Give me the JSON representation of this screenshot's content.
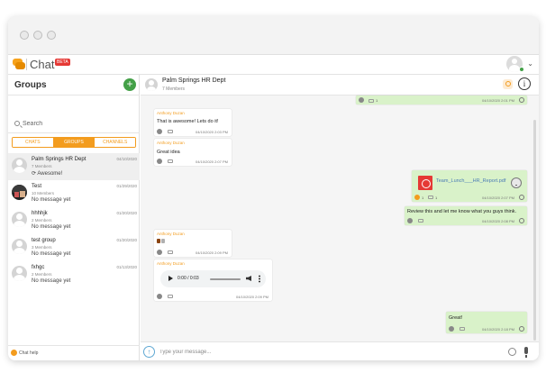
{
  "app": {
    "brand": "Chat",
    "badge": "BETA"
  },
  "sidebar": {
    "title": "Groups",
    "add_label": "+",
    "search_placeholder": "Search",
    "tabs": [
      {
        "label": "CHATS"
      },
      {
        "label": "GROUPS"
      },
      {
        "label": "CHANNELS"
      }
    ],
    "groups": [
      {
        "name": "Palm Springs HR Dept",
        "members": "7 Members",
        "last": "Awesome!",
        "date": "04/10/2020"
      },
      {
        "name": "Test",
        "members": "10 Members",
        "last": "No message yet",
        "date": "01/29/2020"
      },
      {
        "name": "hhhhjk",
        "members": "2 Members",
        "last": "No message yet",
        "date": "01/20/2020"
      },
      {
        "name": "test group",
        "members": "3 Members",
        "last": "No message yet",
        "date": "01/20/2020"
      },
      {
        "name": "fxhgc",
        "members": "2 Members",
        "last": "No message yet",
        "date": "01/13/2020"
      }
    ],
    "help": "Chat help"
  },
  "chat": {
    "title": "Palm Springs HR Dept",
    "members": "7 Members",
    "messages": {
      "m0": {
        "time": "04/10/2020 2:01 PM",
        "count": "1"
      },
      "m1": {
        "sender": "Anthony Duzan",
        "text": "That is awesome! Lets do it!",
        "time": "04/10/2020 2:03 PM"
      },
      "m2": {
        "sender": "Anthony Duzan",
        "text": "Great idea",
        "time": "04/10/2020 2:07 PM"
      },
      "m3": {
        "file": "Team_Lunch___HR_Report.pdf",
        "time": "04/10/2020 2:07 PM",
        "count1": "1",
        "count2": "1"
      },
      "m4": {
        "text": "Review this and let me know what you guys think.",
        "time": "04/10/2020 2:08 PM"
      },
      "m5": {
        "sender": "Anthony Duzan",
        "time": "04/10/2020 2:09 PM"
      },
      "m6": {
        "sender": "Anthony Duzan",
        "audio_time": "0:00 / 0:03",
        "time": "04/10/2020 2:09 PM"
      },
      "m7": {
        "text": "Great!",
        "time": "04/10/2020 2:18 PM"
      }
    },
    "input_placeholder": "Type your message..."
  },
  "icons": {
    "logo": "chat-bubbles-icon",
    "add": "plus-icon",
    "search": "search-icon",
    "info": "info-icon",
    "upload": "upload-icon",
    "emoji": "emoji-icon",
    "mic": "mic-icon"
  }
}
